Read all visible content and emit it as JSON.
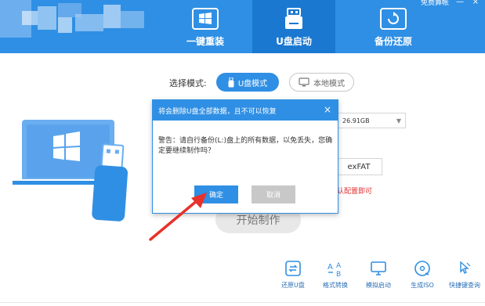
{
  "header": {
    "top_right": {
      "text": "免费算帐",
      "minimize": "—",
      "close": "×"
    },
    "tabs": [
      {
        "label": "一键重装",
        "icon": "windows-icon",
        "active": false
      },
      {
        "label": "U盘启动",
        "icon": "usb-drive-icon",
        "active": true
      },
      {
        "label": "备份还原",
        "icon": "backup-restore-icon",
        "active": false
      }
    ]
  },
  "main": {
    "mode_label": "选择模式:",
    "mode_usb": "U盘模式",
    "mode_local": "本地模式",
    "device_value": "26.91GB",
    "filesystem": "exFAT",
    "red_note": "认配置即可",
    "start_button": "开始制作"
  },
  "dialog": {
    "title": "将会删除U盘全部数据，且不可以恢复",
    "close": "×",
    "message": "警告：请自行备份(L:)盘上的所有数据，以免丢失，您确定要继续制作吗？",
    "ok": "确定",
    "cancel": "取消"
  },
  "toolbar": [
    {
      "label": "还原U盘",
      "icon": "restore-usb-icon"
    },
    {
      "label": "格式转换",
      "icon": "format-convert-icon"
    },
    {
      "label": "模拟启动",
      "icon": "simulate-boot-icon"
    },
    {
      "label": "生成ISO",
      "icon": "iso-disc-icon"
    },
    {
      "label": "快捷键查询",
      "icon": "shortcut-query-icon"
    }
  ],
  "colors": {
    "header_blue": "#2f8fe4",
    "active_tab": "#1a78d1",
    "warning_red": "#e03030",
    "arrow_red": "#e8322b"
  }
}
